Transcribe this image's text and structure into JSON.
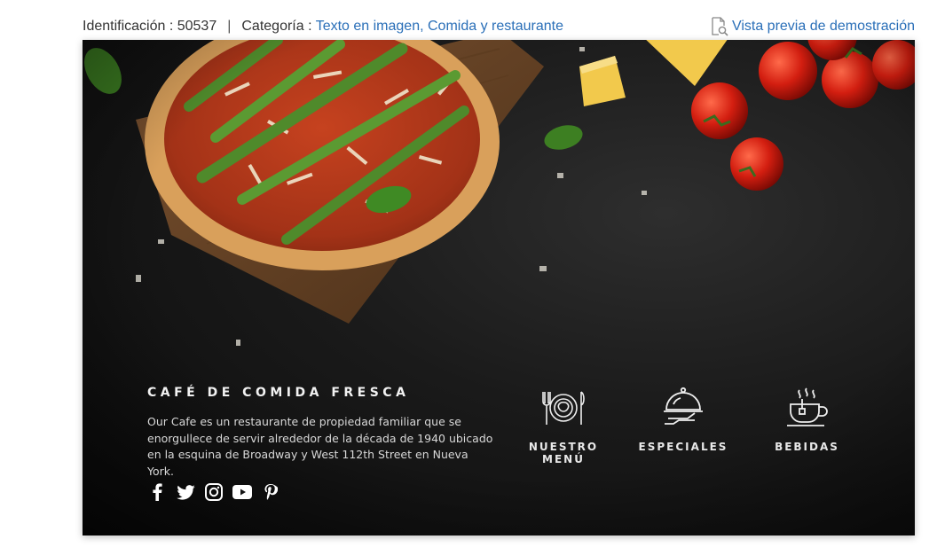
{
  "meta": {
    "id_label": "Identificación : 50537",
    "separator": "|",
    "category_prefix": "Categoría :",
    "category_1": "Texto en imagen",
    "category_comma": ",",
    "category_2": "Comida y restaurante",
    "preview_label": "Vista previa de demostración",
    "link_color": "#2a6fb8"
  },
  "hero": {
    "title": "CAFÉ DE COMIDA FRESCA",
    "description": "Our Cafe es un restaurante de propiedad familiar que se enorgullece de servir alrededor de la década de 1940 ubicado en la esquina de Broadway y West 112th Street en Nueva York.",
    "social_icons": [
      "facebook-icon",
      "twitter-icon",
      "instagram-icon",
      "youtube-icon",
      "pinterest-icon"
    ],
    "nav": [
      {
        "label": "NUESTRO MENÚ",
        "icon": "plate-cutlery-icon"
      },
      {
        "label": "ESPECIALES",
        "icon": "cloche-icon"
      },
      {
        "label": "BEBIDAS",
        "icon": "teacup-icon"
      }
    ]
  }
}
